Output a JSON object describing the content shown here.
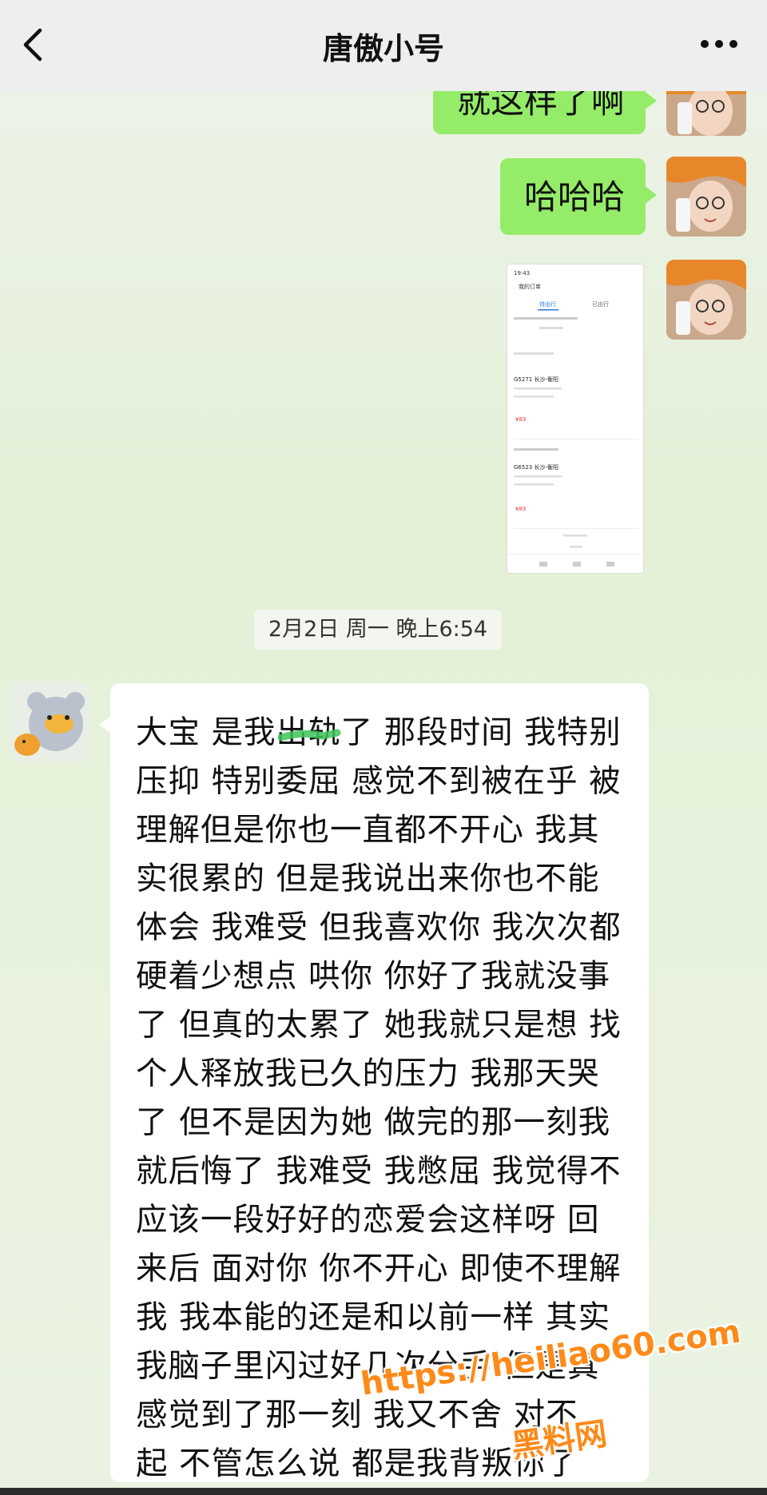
{
  "header": {
    "title": "唐傲小号"
  },
  "messages": {
    "sent_1": "就这样了啊",
    "sent_2": "哈哈哈",
    "timestamp": "2月2日 周一 晚上6:54",
    "received_lines": [
      "大宝 是我出轨了 那段时间 我特别",
      "压抑 特别委屈 感觉不到被在乎 被",
      "理解但是你也一直都不开心  我其",
      "实很累的  但是我说出来你也不能",
      "体会 我难受 但我喜欢你 我次次都",
      "硬着少想点 哄你 你好了我就没事",
      "了 但真的太累了 她我就只是想  找",
      "个人释放我已久的压力 我那天哭",
      "了 但不是因为她 做完的那一刻我",
      "就后悔了  我难受 我憋屈 我觉得不",
      "应该一段好好的恋爱会这样呀  回",
      "来后 面对你 你不开心  即使不理解",
      "我 我本能的还是和以前一样  其实",
      "我脑子里闪过好几次分手  但是真",
      "感觉到了那一刻 我又不舍  对不",
      "起 不管怎么说 都是我背叛你了"
    ]
  },
  "screenshot_thumb": {
    "time": "19:43",
    "title": "我的订单",
    "tab_1": "待出行",
    "tab_2": "已出行",
    "train_1": "G5271 长沙-衡阳",
    "price_1": "¥83",
    "train_2": "G6523 长沙-衡阳",
    "price_2": "¥83"
  },
  "watermark": {
    "url": "https://heiliao60.com",
    "name": "黑料网"
  },
  "icons": {
    "back": "chevron-left-icon",
    "more": "more-dots-icon"
  },
  "colors": {
    "sent_bubble": "#95ec69",
    "received_bubble": "#ffffff",
    "watermark": "#ff8a1a"
  }
}
